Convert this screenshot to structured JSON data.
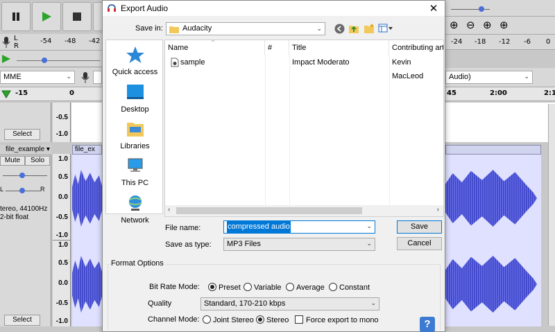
{
  "background": {
    "ruler_left": [
      "-54",
      "-48",
      "-42"
    ],
    "ruler_right": [
      "-24",
      "-18",
      "-12",
      "-6",
      "0"
    ],
    "ruler_l": "L",
    "ruler_r": "R",
    "host_label": "MME",
    "project_rate": "Audio)",
    "timeline_left": [
      "-15",
      "0"
    ],
    "timeline_right": [
      "45",
      "2:00",
      "2:1"
    ],
    "select_label": "Select",
    "scale_top": [
      "-0.5",
      "-1.0"
    ],
    "track_name": "file_example",
    "clip_name": "file_ex",
    "mute_label": "Mute",
    "solo_label": "Solo",
    "pan_l": "L",
    "pan_r": "R",
    "track_info_1": "tereo, 44100Hz",
    "track_info_2": "2-bit float",
    "scale_1": [
      "1.0",
      "0.5",
      "0.0",
      "-0.5",
      "-1.0"
    ],
    "scale_2": [
      "1.0",
      "0.5",
      "0.0",
      "-0.5",
      "-1.0"
    ]
  },
  "dialog": {
    "title": "Export Audio",
    "close_glyph": "✕",
    "save_in_label": "Save in:",
    "save_in_value": "Audacity",
    "nav_items": [
      "Quick access",
      "Desktop",
      "Libraries",
      "This PC",
      "Network"
    ],
    "columns": [
      "Name",
      "#",
      "Title",
      "Contributing art"
    ],
    "files": [
      {
        "name": "sample",
        "number": "",
        "title": "Impact Moderato",
        "artist": "Kevin MacLeod"
      }
    ],
    "file_name_label": "File name:",
    "file_name_value": "compressed audio",
    "save_type_label": "Save as type:",
    "save_type_value": "MP3 Files",
    "save_button": "Save",
    "cancel_button": "Cancel",
    "format_options_label": "Format Options",
    "bit_rate_label": "Bit Rate Mode:",
    "bit_rate_options": [
      {
        "label": "Preset",
        "selected": true
      },
      {
        "label": "Variable",
        "selected": false
      },
      {
        "label": "Average",
        "selected": false
      },
      {
        "label": "Constant",
        "selected": false
      }
    ],
    "quality_label": "Quality",
    "quality_value": "Standard, 170-210 kbps",
    "channel_label": "Channel Mode:",
    "channel_options": [
      {
        "label": "Joint Stereo",
        "selected": false
      },
      {
        "label": "Stereo",
        "selected": true
      }
    ],
    "force_mono_label": "Force export to mono",
    "force_mono_checked": false,
    "help_glyph": "?"
  },
  "colors": {
    "accent": "#0078d7",
    "waveform": "#4b52d3",
    "play_green": "#2ca52c"
  }
}
